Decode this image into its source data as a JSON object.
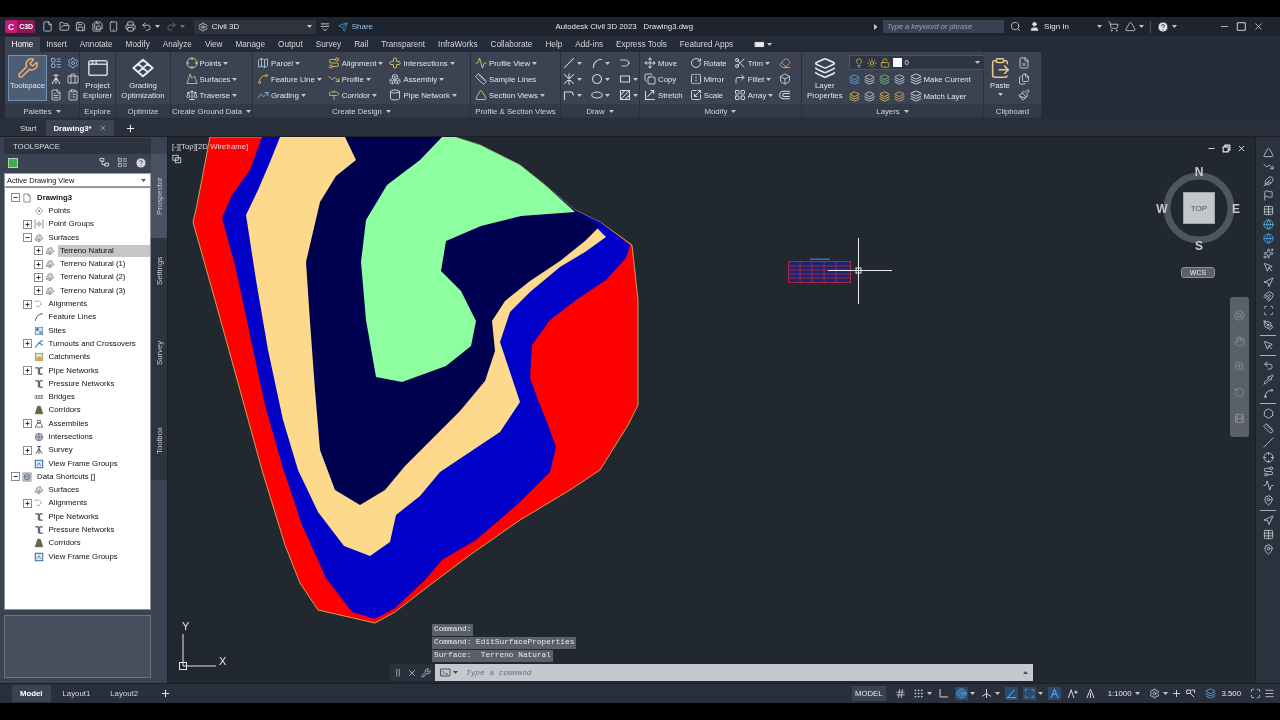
{
  "title_bar": {
    "logo_letter": "C",
    "logo_tag": "C3D",
    "workspace": "Civil 3D",
    "share": "Share",
    "app_title": "Autodesk Civil 3D 2023",
    "file_name": "Drawing3.dwg",
    "search": {
      "placeholder": "Type a keyword or phrase"
    },
    "sign_in": "Sign In"
  },
  "ribbon_tabs": [
    {
      "label": "Home",
      "selected": true
    },
    {
      "label": "Insert",
      "selected": false
    },
    {
      "label": "Annotate",
      "selected": false
    },
    {
      "label": "Modify",
      "selected": false
    },
    {
      "label": "Analyze",
      "selected": false
    },
    {
      "label": "View",
      "selected": false
    },
    {
      "label": "Manage",
      "selected": false
    },
    {
      "label": "Output",
      "selected": false
    },
    {
      "label": "Survey",
      "selected": false
    },
    {
      "label": "Rail",
      "selected": false
    },
    {
      "label": "Transparent",
      "selected": false
    },
    {
      "label": "InfraWorks",
      "selected": false
    },
    {
      "label": "Collaborate",
      "selected": false
    },
    {
      "label": "Help",
      "selected": false
    },
    {
      "label": "Add-ins",
      "selected": false
    },
    {
      "label": "Express Tools",
      "selected": false
    },
    {
      "label": "Featured Apps",
      "selected": false
    }
  ],
  "ribbon_panels": [
    {
      "kind": "standard",
      "title": "Palettes",
      "menu": true,
      "big": [
        {
          "label": "Toolspace",
          "selected": true
        }
      ]
    },
    {
      "kind": "standard",
      "title": "Explore",
      "menu": false,
      "big": [
        {
          "label": "Project Explorer",
          "selected": false
        }
      ]
    },
    {
      "kind": "standard",
      "title": "Optimize",
      "menu": false,
      "big": [
        {
          "label": "Grading Optimization",
          "selected": false
        }
      ]
    },
    {
      "kind": "standard",
      "title": "Create Ground Data",
      "menu": true,
      "columns": [
        [
          {
            "label": "Points",
            "dropdown": true
          },
          {
            "label": "Surfaces",
            "dropdown": true
          },
          {
            "label": "Traverse",
            "dropdown": true
          }
        ]
      ]
    },
    {
      "kind": "standard",
      "title": "Create Design",
      "menu": true,
      "columns": [
        [
          {
            "label": "Parcel",
            "dropdown": true
          },
          {
            "label": "Feature Line",
            "dropdown": true
          },
          {
            "label": "Grading",
            "dropdown": true
          }
        ],
        [
          {
            "label": "Alignment",
            "dropdown": true
          },
          {
            "label": "Profile",
            "dropdown": true
          },
          {
            "label": "Corridor",
            "dropdown": true
          }
        ],
        [
          {
            "label": "Intersections",
            "dropdown": true
          },
          {
            "label": "Assembly",
            "dropdown": true
          },
          {
            "label": "Pipe Network",
            "dropdown": true
          }
        ]
      ]
    },
    {
      "kind": "standard",
      "title": "Profile & Section Views",
      "menu": false,
      "columns": [
        [
          {
            "label": "Profile View",
            "dropdown": true
          },
          {
            "label": "Sample Lines",
            "dropdown": false
          },
          {
            "label": "Section Views",
            "dropdown": true
          }
        ]
      ]
    },
    {
      "kind": "standard",
      "title": "Draw",
      "menu": true,
      "icons": [
        {
          "dropdown": true
        },
        {
          "dropdown": true
        },
        {
          "dropdown": true
        },
        {
          "dropdown": true
        },
        {
          "dropdown": true
        },
        {
          "dropdown": true
        },
        {
          "dropdown": false
        },
        {
          "dropdown": true
        },
        {
          "dropdown": true
        }
      ]
    },
    {
      "kind": "standard",
      "title": "Modify",
      "menu": true,
      "columns": [
        [
          {
            "label": "Move",
            "dropdown": false
          },
          {
            "label": "Copy",
            "dropdown": false
          },
          {
            "label": "Stretch",
            "dropdown": false
          }
        ],
        [
          {
            "label": "Rotate",
            "dropdown": false
          },
          {
            "label": "Mirror",
            "dropdown": false
          },
          {
            "label": "Scale",
            "dropdown": false
          }
        ],
        [
          {
            "label": "Trim",
            "dropdown": true
          },
          {
            "label": "Fillet",
            "dropdown": true
          },
          {
            "label": "Array",
            "dropdown": true
          }
        ]
      ]
    },
    {
      "kind": "layers",
      "title": "Layers",
      "menu": true,
      "big": [
        {
          "label": "Layer Properties",
          "selected": false
        }
      ],
      "layer": "0",
      "rows": [
        {
          "label": "Make Current"
        },
        {
          "label": "Match Layer"
        }
      ]
    },
    {
      "kind": "standard",
      "title": "Clipboard",
      "menu": false,
      "big": [
        {
          "label": "Paste",
          "selected": false,
          "dropdown": true
        }
      ]
    }
  ],
  "file_tabs": [
    {
      "label": "Start",
      "selected": false,
      "closable": false
    },
    {
      "label": "Drawing3*",
      "selected": true,
      "closable": true
    }
  ],
  "toolspace": {
    "title": "TOOLSPACE",
    "view": "Active Drawing View",
    "tree": [
      {
        "label": "Drawing3",
        "kind": "drawing",
        "expanded": true,
        "selected": false,
        "current": true,
        "children": [
          {
            "label": "Points",
            "kind": "points",
            "selected": false
          },
          {
            "label": "Point Groups",
            "kind": "point_groups",
            "expanded": false,
            "selected": false
          },
          {
            "label": "Surfaces",
            "kind": "surface",
            "expanded": true,
            "selected": false,
            "children": [
              {
                "label": "Terreno Natural",
                "kind": "surface",
                "expanded": false,
                "selected": true
              },
              {
                "label": "Terreno Natural (1)",
                "kind": "surface",
                "expanded": false,
                "selected": false
              },
              {
                "label": "Terreno Natural (2)",
                "kind": "surface",
                "expanded": false,
                "selected": false
              },
              {
                "label": "Terreno Natural (3)",
                "kind": "surface",
                "expanded": false,
                "selected": false
              }
            ]
          },
          {
            "label": "Alignments",
            "kind": "alignment",
            "expanded": false,
            "selected": false
          },
          {
            "label": "Feature Lines",
            "kind": "feature_line",
            "selected": false
          },
          {
            "label": "Sites",
            "kind": "site",
            "selected": false
          },
          {
            "label": "Turnouts and Crossovers",
            "kind": "turnout",
            "expanded": false,
            "selected": false
          },
          {
            "label": "Catchments",
            "kind": "catchment",
            "selected": false
          },
          {
            "label": "Pipe Networks",
            "kind": "pipe",
            "expanded": false,
            "selected": false
          },
          {
            "label": "Pressure Networks",
            "kind": "pipe",
            "selected": false
          },
          {
            "label": "Bridges",
            "kind": "bridge",
            "selected": false
          },
          {
            "label": "Corridors",
            "kind": "corridor",
            "selected": false
          },
          {
            "label": "Assemblies",
            "kind": "assembly",
            "expanded": false,
            "selected": false
          },
          {
            "label": "Intersections",
            "kind": "intersection",
            "selected": false
          },
          {
            "label": "Survey",
            "kind": "survey",
            "expanded": false,
            "selected": false
          },
          {
            "label": "View Frame Groups",
            "kind": "view_frame",
            "selected": false
          }
        ]
      },
      {
        "label": "Data Shortcuts []",
        "kind": "shortcuts",
        "expanded": true,
        "selected": false,
        "current": false,
        "children": [
          {
            "label": "Surfaces",
            "kind": "surface",
            "selected": false
          },
          {
            "label": "Alignments",
            "kind": "alignment",
            "expanded": false,
            "selected": false
          },
          {
            "label": "Pipe Networks",
            "kind": "pipe",
            "selected": false
          },
          {
            "label": "Pressure Networks",
            "kind": "pipe",
            "selected": false
          },
          {
            "label": "Corridors",
            "kind": "corridor",
            "selected": false
          },
          {
            "label": "View Frame Groups",
            "kind": "view_frame",
            "selected": false
          }
        ]
      }
    ],
    "side_tabs": [
      {
        "label": "Prospector",
        "selected": true
      },
      {
        "label": "Settings",
        "selected": false
      },
      {
        "label": "Survey",
        "selected": false
      },
      {
        "label": "Toolbox",
        "selected": false
      }
    ]
  },
  "viewport": {
    "controls": [
      "[-]",
      "[Top]",
      "[2D Wireframe]"
    ],
    "viewcube": {
      "face": "TOP",
      "north": "N",
      "south": "S",
      "east": "E",
      "west": "W",
      "ucs_menu": "WCS"
    },
    "ucs_icon": {
      "x": "X",
      "y": "Y"
    }
  },
  "command_line": {
    "history": [
      "Command:",
      "Command: EditSurfaceProperties",
      "Surface:  Terreno Natural"
    ],
    "placeholder": "Type a command"
  },
  "status_bar": {
    "layout_tabs": [
      {
        "label": "Model",
        "selected": true
      },
      {
        "label": "Layout1",
        "selected": false
      },
      {
        "label": "Layout2",
        "selected": false
      }
    ],
    "space": "MODEL",
    "toggles": [
      {
        "kind": "plain",
        "on": false
      },
      {
        "kind": "menu",
        "on": false
      },
      {
        "kind": "plain",
        "on": false
      },
      {
        "kind": "menu",
        "on": true
      },
      {
        "kind": "menu",
        "on": false
      },
      {
        "kind": "plain",
        "on": true
      },
      {
        "kind": "menu",
        "on": true
      },
      {
        "kind": "plain",
        "on": true
      },
      {
        "kind": "plain",
        "on": false
      },
      {
        "kind": "plain",
        "on": false
      }
    ],
    "annotation_scale": "1:1000",
    "lineweight": "3.500"
  }
}
